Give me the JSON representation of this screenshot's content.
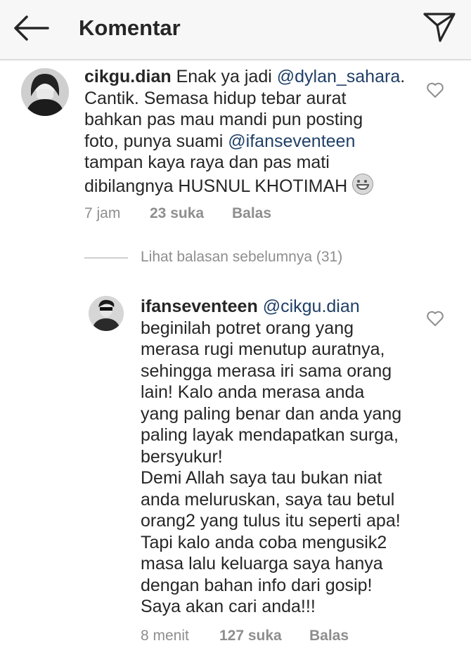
{
  "header": {
    "title": "Komentar"
  },
  "comments": [
    {
      "username": "cikgu.dian",
      "text_parts": [
        " Enak ya jadi ",
        "@dylan_sahara",
        ".\nCantik. Semasa hidup tebar aurat\nbahkan pas mau mandi pun posting\nfoto, punya suami ",
        "@ifanseventeen",
        "\ntampan kaya raya dan pas mati\ndibilangnya HUSNUL KHOTIMAH "
      ],
      "emoji": "grinning-face-emoji",
      "time": "7 jam",
      "likes": "23 suka",
      "reply": "Balas"
    },
    {
      "username": "ifanseventeen",
      "text_parts": [
        " ",
        "@cikgu.dian",
        "\nbeginilah potret orang yang\nmerasa rugi menutup auratnya,\nsehingga merasa iri sama orang\nlain! Kalo anda merasa anda\nyang paling benar dan anda yang\npaling layak mendapatkan surga,\nbersyukur!\nDemi Allah saya tau bukan niat\nanda meluruskan, saya tau betul\norang2 yang tulus itu seperti apa!\nTapi kalo anda coba mengusik2\nmasa lalu keluarga saya hanya\ndengan bahan info dari gosip!\nSaya akan cari anda!!!"
      ],
      "time": "8 menit",
      "likes": "127 suka",
      "reply": "Balas"
    }
  ],
  "view_replies": "Lihat balasan sebelumnya (31)",
  "colors": {
    "mention": "#1f3f67",
    "meta": "#8e8e8e",
    "header_bg": "#f7f7f7"
  },
  "icons": [
    "back-arrow-icon",
    "send-icon",
    "heart-icon"
  ]
}
